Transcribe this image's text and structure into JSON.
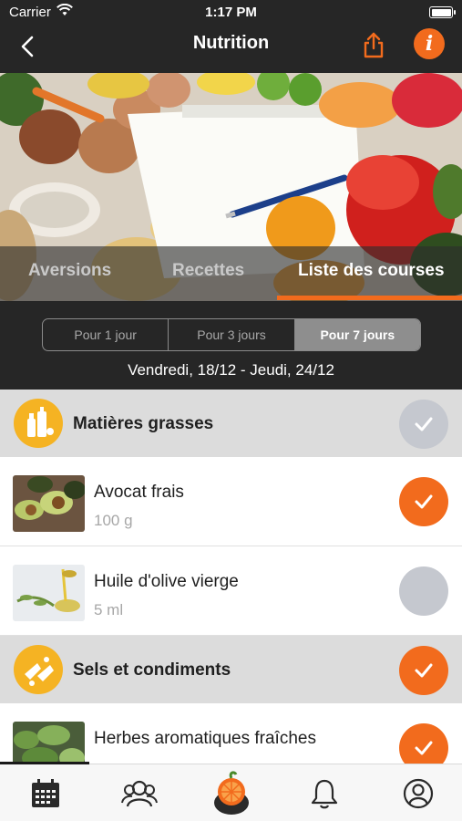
{
  "status": {
    "carrier": "Carrier",
    "time": "1:17 PM"
  },
  "nav": {
    "title": "Nutrition",
    "back_icon": "chevron-left-icon",
    "share_icon": "share-icon",
    "info_icon": "info-icon",
    "info_glyph": "i",
    "accent_color": "#f26b1d"
  },
  "tabs": [
    {
      "label": "Aversions",
      "active": false
    },
    {
      "label": "Recettes",
      "active": false
    },
    {
      "label": "Liste des courses",
      "active": true
    }
  ],
  "period": {
    "options": [
      "Pour 1 jour",
      "Pour 3 jours",
      "Pour 7 jours"
    ],
    "selected": "Pour 7 jours",
    "date_range": "Vendredi, 18/12 - Jeudi, 24/12"
  },
  "list": {
    "categories": [
      {
        "label": "Matières grasses",
        "icon": "oil-bottles-icon",
        "checked": false
      },
      {
        "label": "Sels et condiments",
        "icon": "salt-icon",
        "checked": true
      }
    ],
    "items": [
      {
        "name": "Avocat frais",
        "quantity": "100 g",
        "checked": true,
        "image": "avocado-photo"
      },
      {
        "name": "Huile d'olive vierge",
        "quantity": "5 ml",
        "checked": false,
        "image": "olive-oil-photo"
      },
      {
        "name": "Herbes aromatiques fraîches",
        "quantity": "",
        "checked": true,
        "image": "herbs-photo"
      }
    ]
  },
  "tabbar": {
    "items": [
      "calendar-icon",
      "community-icon",
      "nutrition-orange-icon",
      "bell-icon",
      "profile-icon"
    ]
  }
}
